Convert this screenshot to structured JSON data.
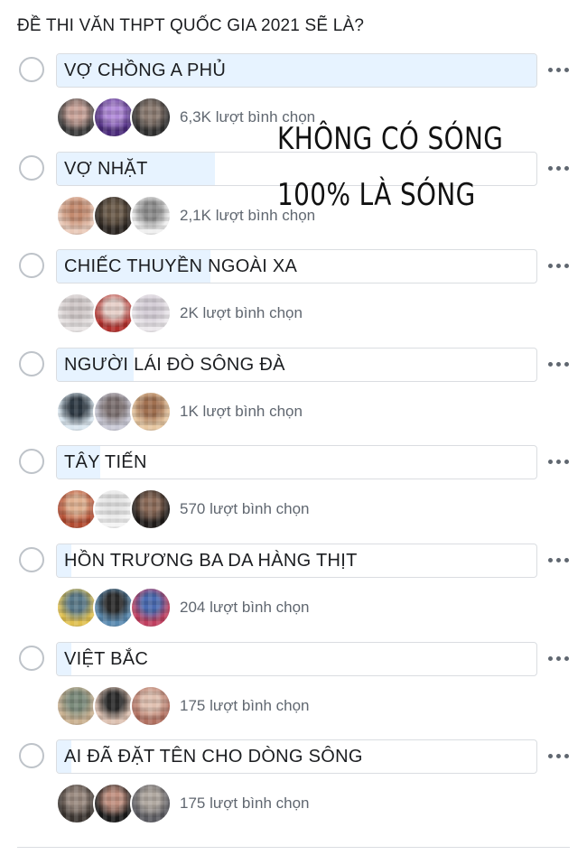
{
  "question": "ĐỀ THI VĂN THPT QUỐC GIA 2021 SẼ LÀ?",
  "options": [
    {
      "label": "VỢ CHỒNG A PHỦ",
      "votes_text": "6,3K lượt bình chọn",
      "share": 1.0,
      "avatar_colors": [
        [
          "#3a3a3a",
          "#caa49a"
        ],
        [
          "#4a2a7a",
          "#b08ad8"
        ],
        [
          "#2d2d2d",
          "#8a7a70"
        ]
      ]
    },
    {
      "label": "VỢ NHẶT",
      "votes_text": "2,1K lượt bình chọn",
      "share": 0.33,
      "avatar_colors": [
        [
          "#e9c9b8",
          "#c38a6e"
        ],
        [
          "#2a2420",
          "#6b5b4a"
        ],
        [
          "#efefef",
          "#8c8c8c"
        ]
      ]
    },
    {
      "label": "CHIẾC THUYỀN NGOÀI XA",
      "votes_text": "2K lượt bình chọn",
      "share": 0.32,
      "avatar_colors": [
        [
          "#e8e4e4",
          "#cfc7c7"
        ],
        [
          "#b0302c",
          "#e6cfc8"
        ],
        [
          "#ece8ec",
          "#d4cdd6"
        ]
      ]
    },
    {
      "label": "NGƯỜI LÁI ĐÒ SÔNG ĐÀ",
      "votes_text": "1K lượt bình chọn",
      "share": 0.16,
      "avatar_colors": [
        [
          "#d9e6ef",
          "#2f3a44"
        ],
        [
          "#c9c9d6",
          "#7b6f6f"
        ],
        [
          "#e6c6a0",
          "#a07050"
        ]
      ]
    },
    {
      "label": "TÂY TIẾN",
      "votes_text": "570 lượt bình chọn",
      "share": 0.09,
      "avatar_colors": [
        [
          "#b04a30",
          "#e0b090"
        ],
        [
          "#f4f4f4",
          "#e2e2e2"
        ],
        [
          "#1e1a18",
          "#8a6a58"
        ]
      ]
    },
    {
      "label": "HỒN TRƯƠNG BA DA HÀNG THỊT",
      "votes_text": "204 lượt bình chọn",
      "share": 0.03,
      "avatar_colors": [
        [
          "#e0c050",
          "#5a7a8a"
        ],
        [
          "#5a8ab0",
          "#2a2a2a"
        ],
        [
          "#c04060",
          "#4a6ab0"
        ]
      ]
    },
    {
      "label": "VIỆT BẮC",
      "votes_text": "175 lượt bình chọn",
      "share": 0.03,
      "avatar_colors": [
        [
          "#c9b090",
          "#7a8a7a"
        ],
        [
          "#dcc0b0",
          "#2a2a2a"
        ],
        [
          "#b07060",
          "#e0c0b0"
        ]
      ]
    },
    {
      "label": "AI ĐÃ ĐẶT TÊN CHO DÒNG SÔNG",
      "votes_text": "175 lượt bình chọn",
      "share": 0.03,
      "avatar_colors": [
        [
          "#3a3430",
          "#9a8a80"
        ],
        [
          "#1a1a1a",
          "#c09080"
        ],
        [
          "#5a5a60",
          "#b0a8a0"
        ]
      ]
    }
  ],
  "overlay_text": {
    "line1": "KHÔNG CÓ SÓNG",
    "line2": "100% LÀ SÓNG"
  },
  "colors": {
    "bar_fill": "#e7f3ff",
    "bar_border": "#dadde1",
    "radio_border": "#bec3c9",
    "secondary_text": "#606770"
  },
  "icons": {
    "radio": "radio-button-icon",
    "more": "more-options-icon"
  }
}
